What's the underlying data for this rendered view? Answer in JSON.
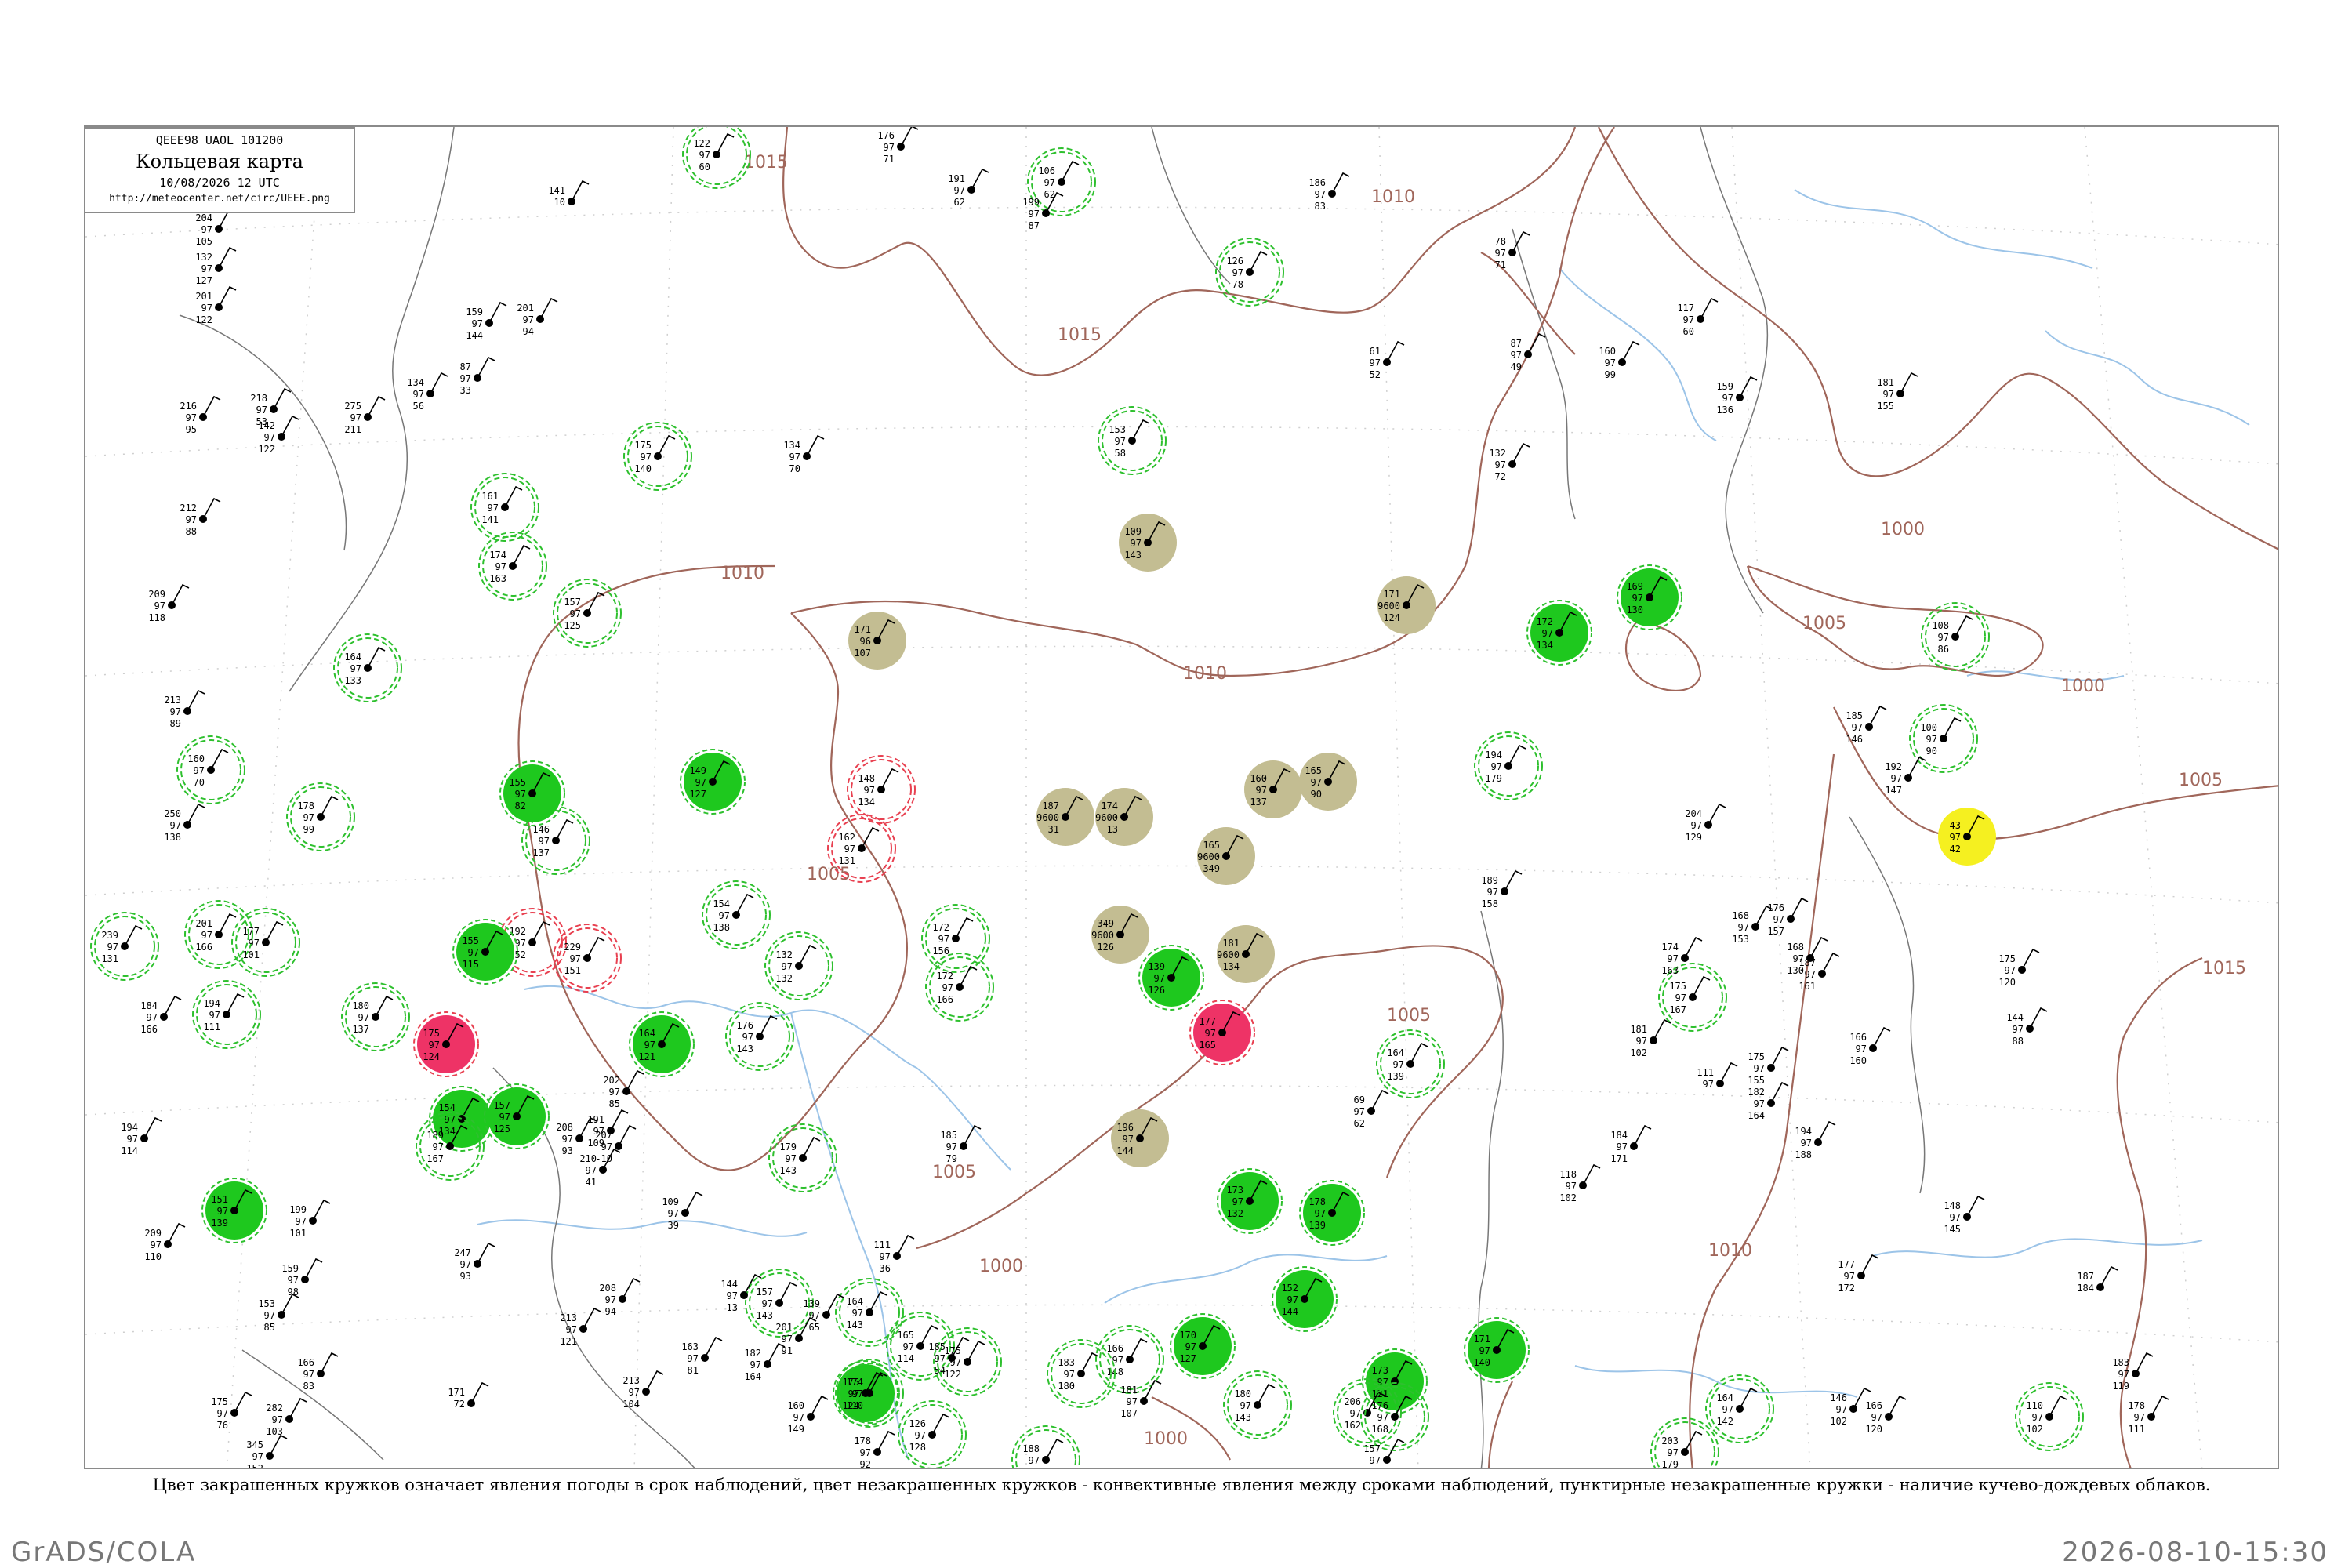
{
  "legend": {
    "code_line": "QEEE98  UAOL  101200",
    "title": "Кольцевая карта",
    "date": "10/08/2026 12 UTC",
    "url": "http://meteocenter.net/circ/UEEE.png"
  },
  "caption": "Цвет закрашенных кружков означает явления погоды в срок наблюдений, цвет незакрашенных кружков - конвективные явления между сроками наблюдений, пунктирные незакрашенные кружки - наличие кучево-дождевых облаков.",
  "footer": {
    "left": "GrADS/COLA",
    "right": "2026-08-10-15:30"
  },
  "colors": {
    "isobar": "#a0665a",
    "river": "#9cc4e8",
    "ring_green": "#2ec02e",
    "ring_red": "#e84050",
    "fill_green": "#1ec81e",
    "fill_khaki": "#c3bd92",
    "fill_red": "#ee3366",
    "fill_yellow": "#f5f020"
  },
  "isobar_labels": [
    {
      "value": "1015"
    },
    {
      "value": "1015"
    },
    {
      "value": "1010"
    },
    {
      "value": "1010"
    },
    {
      "value": "1010"
    },
    {
      "value": "1005"
    },
    {
      "value": "1005"
    },
    {
      "value": "1005"
    },
    {
      "value": "1005"
    },
    {
      "value": "1000"
    },
    {
      "value": "1000"
    },
    {
      "value": "1000"
    },
    {
      "value": "1005"
    },
    {
      "value": "1015"
    },
    {
      "value": "1010"
    },
    {
      "value": "1000"
    }
  ],
  "stations": [
    {
      "t": "132",
      "p": "97",
      "v": "127",
      "name": "",
      "mark": "none"
    },
    {
      "t": "204",
      "p": "97",
      "v": "105",
      "name": "",
      "mark": "none"
    },
    {
      "t": "201",
      "p": "97",
      "v": "122",
      "name": "",
      "mark": "none"
    },
    {
      "t": "216",
      "p": "97",
      "v": "95",
      "name": "",
      "mark": "none"
    },
    {
      "t": "218",
      "p": "97",
      "v": "53",
      "name": "",
      "mark": "none"
    },
    {
      "t": "142",
      "p": "97",
      "v": "122",
      "name": "",
      "mark": "none"
    },
    {
      "t": "212",
      "p": "97",
      "v": "88",
      "name": "",
      "mark": "none"
    },
    {
      "t": "209",
      "p": "97",
      "v": "118",
      "name": "",
      "mark": "none"
    },
    {
      "t": "213",
      "p": "97",
      "v": "89",
      "name": "",
      "mark": "none"
    },
    {
      "t": "160",
      "p": "97",
      "v": "70",
      "name": "",
      "mark": "ring-green"
    },
    {
      "t": "250",
      "p": "97",
      "v": "138",
      "name": "",
      "mark": "none"
    },
    {
      "t": "239",
      "p": "97",
      "v": "131",
      "name": "",
      "mark": "ring-green"
    },
    {
      "t": "201",
      "p": "97",
      "v": "166",
      "name": "",
      "mark": "ring-green"
    },
    {
      "t": "177",
      "p": "97",
      "v": "101",
      "name": "",
      "mark": "ring-green"
    },
    {
      "t": "180",
      "p": "97",
      "v": "137",
      "name": "",
      "mark": "ring-green"
    },
    {
      "t": "194",
      "p": "97",
      "v": "111",
      "name": "",
      "mark": "ring-green"
    },
    {
      "t": "175",
      "p": "97",
      "v": "140",
      "name": "",
      "mark": "ring-green"
    },
    {
      "t": "161",
      "p": "97",
      "v": "141",
      "name": "",
      "mark": "ring-green"
    },
    {
      "t": "174",
      "p": "97",
      "v": "163",
      "name": "",
      "mark": "ring-green"
    },
    {
      "t": "157",
      "p": "97",
      "v": "125",
      "name": "",
      "mark": "ring-green"
    },
    {
      "t": "164",
      "p": "97",
      "v": "133",
      "name": "",
      "mark": "ring-green"
    },
    {
      "t": "178",
      "p": "97",
      "v": "99",
      "name": "",
      "mark": "ring-green"
    },
    {
      "t": "146",
      "p": "97",
      "v": "137",
      "name": "",
      "mark": "ring-green"
    },
    {
      "t": "192",
      "p": "97",
      "v": "152",
      "name": "",
      "mark": "ring-red"
    },
    {
      "t": "229",
      "p": "97",
      "v": "151",
      "name": "",
      "mark": "ring-red"
    },
    {
      "t": "148",
      "p": "97",
      "v": "134",
      "name": "",
      "mark": "ring-red"
    },
    {
      "t": "162",
      "p": "97",
      "v": "131",
      "name": "",
      "mark": "ring-red"
    },
    {
      "t": "154",
      "p": "97",
      "v": "138",
      "name": "",
      "mark": "ring-green"
    },
    {
      "t": "132",
      "p": "97",
      "v": "132",
      "name": "",
      "mark": "ring-green"
    },
    {
      "t": "176",
      "p": "97",
      "v": "143",
      "name": "",
      "mark": "ring-green"
    },
    {
      "t": "172",
      "p": "97",
      "v": "156",
      "name": "",
      "mark": "ring-green"
    },
    {
      "t": "172",
      "p": "97",
      "v": "166",
      "name": "",
      "mark": "ring-green"
    },
    {
      "t": "187",
      "p": "9600",
      "v": "31",
      "name": "",
      "mark": "fill-khaki"
    },
    {
      "t": "174",
      "p": "9600",
      "v": "13",
      "name": "",
      "mark": "fill-khaki"
    },
    {
      "t": "160",
      "p": "97",
      "v": "137",
      "name": "",
      "mark": "fill-khaki"
    },
    {
      "t": "165",
      "p": "9600",
      "v": "349",
      "name": "",
      "mark": "fill-khaki"
    },
    {
      "t": "165",
      "p": "97",
      "v": "90",
      "name": "",
      "mark": "fill-khaki"
    },
    {
      "t": "349",
      "p": "9600",
      "v": "126",
      "name": "",
      "mark": "fill-khaki"
    },
    {
      "t": "171",
      "p": "96",
      "v": "107",
      "name": "",
      "mark": "fill-khaki"
    },
    {
      "t": "109",
      "p": "97",
      "v": "143",
      "name": "",
      "mark": "fill-khaki"
    },
    {
      "t": "171",
      "p": "9600",
      "v": "124",
      "name": "",
      "mark": "fill-khaki"
    },
    {
      "t": "196",
      "p": "97",
      "v": "144",
      "name": "",
      "mark": "fill-khaki"
    },
    {
      "t": "181",
      "p": "9600",
      "v": "134",
      "name": "",
      "mark": "fill-khaki"
    },
    {
      "t": "175",
      "p": "97",
      "v": "124",
      "name": "",
      "mark": "fill-red"
    },
    {
      "t": "177",
      "p": "97",
      "v": "165",
      "name": "",
      "mark": "fill-red"
    },
    {
      "t": "43",
      "p": "97",
      "v": "42",
      "name": "",
      "mark": "fill-yellow"
    },
    {
      "t": "155",
      "p": "97",
      "v": "82",
      "name": "",
      "mark": "fill-green"
    },
    {
      "t": "149",
      "p": "97",
      "v": "127",
      "name": "",
      "mark": "fill-green"
    },
    {
      "t": "155",
      "p": "97",
      "v": "115",
      "name": "",
      "mark": "fill-green"
    },
    {
      "t": "154",
      "p": "97",
      "v": "134",
      "name": "",
      "mark": "fill-green"
    },
    {
      "t": "151",
      "p": "97",
      "v": "139",
      "name": "",
      "mark": "fill-green"
    },
    {
      "t": "164",
      "p": "97",
      "v": "121",
      "name": "",
      "mark": "fill-green"
    },
    {
      "t": "157",
      "p": "97",
      "v": "125",
      "name": "",
      "mark": "fill-green"
    },
    {
      "t": "139",
      "p": "97",
      "v": "126",
      "name": "",
      "mark": "fill-green"
    },
    {
      "t": "173",
      "p": "97",
      "v": "132",
      "name": "",
      "mark": "fill-green"
    },
    {
      "t": "178",
      "p": "97",
      "v": "139",
      "name": "",
      "mark": "fill-green"
    },
    {
      "t": "152",
      "p": "97",
      "v": "144",
      "name": "",
      "mark": "fill-green"
    },
    {
      "t": "173",
      "p": "97",
      "v": "121",
      "name": "",
      "mark": "fill-green"
    },
    {
      "t": "171",
      "p": "97",
      "v": "140",
      "name": "",
      "mark": "fill-green"
    },
    {
      "t": "170",
      "p": "97",
      "v": "127",
      "name": "",
      "mark": "fill-green"
    },
    {
      "t": "169",
      "p": "97",
      "v": "130",
      "name": "",
      "mark": "fill-green"
    },
    {
      "t": "175",
      "p": "97",
      "v": "124",
      "name": "",
      "mark": "fill-green"
    },
    {
      "t": "172",
      "p": "97",
      "v": "134",
      "name": "",
      "mark": "fill-green"
    },
    {
      "t": "122",
      "p": "97",
      "v": "60",
      "name": "",
      "mark": "ring-green"
    },
    {
      "t": "106",
      "p": "97",
      "v": "62",
      "name": "",
      "mark": "ring-green"
    },
    {
      "t": "126",
      "p": "97",
      "v": "78",
      "name": "",
      "mark": "ring-green"
    },
    {
      "t": "153",
      "p": "97",
      "v": "58",
      "name": "",
      "mark": "ring-green"
    },
    {
      "t": "108",
      "p": "97",
      "v": "86",
      "name": "",
      "mark": "ring-green"
    },
    {
      "t": "100",
      "p": "97",
      "v": "90",
      "name": "",
      "mark": "ring-green"
    },
    {
      "t": "194",
      "p": "97",
      "v": "179",
      "name": "",
      "mark": "ring-green"
    },
    {
      "t": "164",
      "p": "97",
      "v": "139",
      "name": "",
      "mark": "ring-green"
    },
    {
      "t": "175",
      "p": "97",
      "v": "167",
      "name": "",
      "mark": "ring-green"
    },
    {
      "t": "189",
      "p": "97",
      "v": "167",
      "name": "",
      "mark": "ring-green"
    },
    {
      "t": "179",
      "p": "97",
      "v": "143",
      "name": "",
      "mark": "ring-green"
    },
    {
      "t": "157",
      "p": "97",
      "v": "143",
      "name": "",
      "mark": "ring-green"
    },
    {
      "t": "164",
      "p": "97",
      "v": "143",
      "name": "",
      "mark": "ring-green"
    },
    {
      "t": "165",
      "p": "97",
      "v": "114",
      "name": "",
      "mark": "ring-green"
    },
    {
      "t": "166",
      "p": "97",
      "v": "148",
      "name": "",
      "mark": "ring-green"
    },
    {
      "t": "183",
      "p": "97",
      "v": "180",
      "name": "",
      "mark": "ring-green"
    },
    {
      "t": "180",
      "p": "97",
      "v": "143",
      "name": "",
      "mark": "ring-green"
    },
    {
      "t": "206",
      "p": "97",
      "v": "162",
      "name": "",
      "mark": "ring-green"
    },
    {
      "t": "176",
      "p": "97",
      "v": "168",
      "name": "",
      "mark": "ring-green"
    },
    {
      "t": "188",
      "p": "97",
      "v": "172",
      "name": "",
      "mark": "ring-green"
    },
    {
      "t": "203",
      "p": "97",
      "v": "179",
      "name": "",
      "mark": "ring-green"
    },
    {
      "t": "110",
      "p": "97",
      "v": "102",
      "name": "",
      "mark": "ring-green"
    },
    {
      "t": "164",
      "p": "97",
      "v": "142",
      "name": "",
      "mark": "ring-green"
    },
    {
      "t": "160",
      "p": "97",
      "v": "149",
      "name": "",
      "mark": "none"
    },
    {
      "t": "174",
      "p": "97",
      "v": "110",
      "name": "",
      "mark": "ring-green"
    },
    {
      "t": "126",
      "p": "97",
      "v": "128",
      "name": "",
      "mark": "ring-green"
    },
    {
      "t": "175",
      "p": "97",
      "v": "122",
      "name": "",
      "mark": "ring-green"
    },
    {
      "t": "111",
      "p": "97",
      "v": "36",
      "name": "",
      "mark": "none"
    },
    {
      "t": "185",
      "p": "97",
      "v": "54",
      "name": "",
      "mark": "none"
    },
    {
      "t": "139",
      "p": "97",
      "v": "65",
      "name": "",
      "mark": "none"
    },
    {
      "t": "176",
      "p": "97",
      "v": "71",
      "name": "",
      "mark": "none"
    },
    {
      "t": "186",
      "p": "97",
      "v": "83",
      "name": "",
      "mark": "none"
    },
    {
      "t": "191",
      "p": "97",
      "v": "62",
      "name": "",
      "mark": "none"
    },
    {
      "t": "199",
      "p": "97",
      "v": "87",
      "name": "",
      "mark": "none"
    },
    {
      "t": "141",
      "p": "10",
      "v": "",
      "name": "",
      "mark": "none"
    },
    {
      "t": "201",
      "p": "97",
      "v": "94",
      "name": "",
      "mark": "none"
    },
    {
      "t": "159",
      "p": "97",
      "v": "144",
      "name": "",
      "mark": "none"
    },
    {
      "t": "87",
      "p": "97",
      "v": "33",
      "name": "",
      "mark": "none"
    },
    {
      "t": "134",
      "p": "97",
      "v": "56",
      "name": "",
      "mark": "none"
    },
    {
      "t": "275",
      "p": "97",
      "v": "211",
      "name": "",
      "mark": "none"
    },
    {
      "t": "134",
      "p": "97",
      "v": "70",
      "name": "",
      "mark": "none"
    },
    {
      "t": "78",
      "p": "97",
      "v": "71",
      "name": "",
      "mark": "none"
    },
    {
      "t": "61",
      "p": "97",
      "v": "52",
      "name": "",
      "mark": "none"
    },
    {
      "t": "87",
      "p": "97",
      "v": "49",
      "name": "",
      "mark": "none"
    },
    {
      "t": "132",
      "p": "97",
      "v": "72",
      "name": "",
      "mark": "none"
    },
    {
      "t": "117",
      "p": "97",
      "v": "60",
      "name": "",
      "mark": "none"
    },
    {
      "t": "160",
      "p": "97",
      "v": "99",
      "name": "",
      "mark": "none"
    },
    {
      "t": "159",
      "p": "97",
      "v": "136",
      "name": "",
      "mark": "none"
    },
    {
      "t": "181",
      "p": "97",
      "v": "155",
      "name": "",
      "mark": "none"
    },
    {
      "t": "185",
      "p": "97",
      "v": "146",
      "name": "",
      "mark": "none"
    },
    {
      "t": "192",
      "p": "97",
      "v": "147",
      "name": "",
      "mark": "none"
    },
    {
      "t": "204",
      "p": "97",
      "v": "129",
      "name": "",
      "mark": "none"
    },
    {
      "t": "189",
      "p": "97",
      "v": "158",
      "name": "",
      "mark": "none"
    },
    {
      "t": "168",
      "p": "97",
      "v": "153",
      "name": "",
      "mark": "none"
    },
    {
      "t": "174",
      "p": "97",
      "v": "163",
      "name": "",
      "mark": "none"
    },
    {
      "t": "168",
      "p": "97",
      "v": "130",
      "name": "",
      "mark": "none"
    },
    {
      "t": "166",
      "p": "97",
      "v": "160",
      "name": "",
      "mark": "none"
    },
    {
      "t": "176",
      "p": "97",
      "v": "157",
      "name": "",
      "mark": "none"
    },
    {
      "t": "187",
      "p": "97",
      "v": "161",
      "name": "",
      "mark": "none"
    },
    {
      "t": "175",
      "p": "97",
      "v": "155",
      "name": "",
      "mark": "none"
    },
    {
      "t": "194",
      "p": "97",
      "v": "188",
      "name": "",
      "mark": "none"
    },
    {
      "t": "181",
      "p": "97",
      "v": "102",
      "name": "",
      "mark": "none"
    },
    {
      "t": "111",
      "p": "97",
      "v": "",
      "name": "",
      "mark": "none"
    },
    {
      "t": "118",
      "p": "97",
      "v": "102",
      "name": "",
      "mark": "none"
    },
    {
      "t": "69",
      "p": "97",
      "v": "62",
      "name": "",
      "mark": "none"
    },
    {
      "t": "184",
      "p": "97",
      "v": "171",
      "name": "",
      "mark": "none"
    },
    {
      "t": "182",
      "p": "97",
      "v": "164",
      "name": "",
      "mark": "none"
    },
    {
      "t": "148",
      "p": "97",
      "v": "145",
      "name": "",
      "mark": "none"
    },
    {
      "t": "177",
      "p": "97",
      "v": "172",
      "name": "",
      "mark": "none"
    },
    {
      "t": "187",
      "p": "184",
      "v": "",
      "name": "",
      "mark": "none"
    },
    {
      "t": "144",
      "p": "97",
      "v": "88",
      "name": "",
      "mark": "none"
    },
    {
      "t": "175",
      "p": "97",
      "v": "120",
      "name": "",
      "mark": "none"
    },
    {
      "t": "183",
      "p": "97",
      "v": "119",
      "name": "",
      "mark": "none"
    },
    {
      "t": "178",
      "p": "97",
      "v": "111",
      "name": "",
      "mark": "none"
    },
    {
      "t": "146",
      "p": "97",
      "v": "102",
      "name": "",
      "mark": "none"
    },
    {
      "t": "166",
      "p": "97",
      "v": "120",
      "name": "",
      "mark": "none"
    },
    {
      "t": "157",
      "p": "97",
      "v": "140",
      "name": "",
      "mark": "none"
    },
    {
      "t": "181",
      "p": "97",
      "v": "107",
      "name": "",
      "mark": "none"
    },
    {
      "t": "247",
      "p": "97",
      "v": "93",
      "name": "",
      "mark": "none"
    },
    {
      "t": "210",
      "p": "97",
      "v": "41",
      "name": "",
      "mark": "none"
    },
    {
      "t": "208",
      "p": "97",
      "v": "93",
      "name": "",
      "mark": "none"
    },
    {
      "t": "191",
      "p": "97",
      "v": "109",
      "name": "",
      "mark": "none"
    },
    {
      "t": "202",
      "p": "97",
      "v": "85",
      "name": "",
      "mark": "none"
    },
    {
      "t": "207",
      "p": "97",
      "v": "-10",
      "name": "",
      "mark": "none"
    },
    {
      "t": "109",
      "p": "97",
      "v": "39",
      "name": "",
      "mark": "none"
    },
    {
      "t": "185",
      "p": "97",
      "v": "79",
      "name": "",
      "mark": "none"
    },
    {
      "t": "194",
      "p": "97",
      "v": "114",
      "name": "",
      "mark": "none"
    },
    {
      "t": "209",
      "p": "97",
      "v": "110",
      "name": "",
      "mark": "none"
    },
    {
      "t": "199",
      "p": "97",
      "v": "101",
      "name": "",
      "mark": "none"
    },
    {
      "t": "153",
      "p": "97",
      "v": "85",
      "name": "",
      "mark": "none"
    },
    {
      "t": "159",
      "p": "97",
      "v": "98",
      "name": "",
      "mark": "none"
    },
    {
      "t": "166",
      "p": "97",
      "v": "83",
      "name": "",
      "mark": "none"
    },
    {
      "t": "175",
      "p": "97",
      "v": "76",
      "name": "",
      "mark": "none"
    },
    {
      "t": "282",
      "p": "97",
      "v": "103",
      "name": "",
      "mark": "none"
    },
    {
      "t": "345",
      "p": "97",
      "v": "152",
      "name": "",
      "mark": "none"
    },
    {
      "t": "171",
      "p": "72",
      "v": "",
      "name": "",
      "mark": "none"
    },
    {
      "t": "208",
      "p": "97",
      "v": "94",
      "name": "",
      "mark": "none"
    },
    {
      "t": "213",
      "p": "97",
      "v": "121",
      "name": "",
      "mark": "none"
    },
    {
      "t": "213",
      "p": "97",
      "v": "104",
      "name": "",
      "mark": "none"
    },
    {
      "t": "163",
      "p": "97",
      "v": "81",
      "name": "",
      "mark": "none"
    },
    {
      "t": "201",
      "p": "97",
      "v": "91",
      "name": "",
      "mark": "none"
    },
    {
      "t": "182",
      "p": "97",
      "v": "164",
      "name": "",
      "mark": "none"
    },
    {
      "t": "178",
      "p": "97",
      "v": "92",
      "name": "",
      "mark": "none"
    },
    {
      "t": "144",
      "p": "97",
      "v": "13",
      "name": "",
      "mark": "none"
    },
    {
      "t": "184",
      "p": "97",
      "v": "166",
      "name": "",
      "mark": "none"
    }
  ]
}
